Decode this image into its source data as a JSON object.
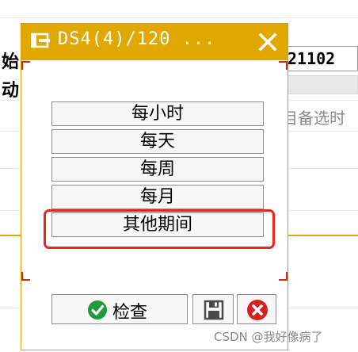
{
  "background": {
    "label_start": "始",
    "label_action": "动",
    "field_value": "21102",
    "hint_text": "目备选时"
  },
  "dialog": {
    "title": "DS4(4)/120 ...",
    "options": [
      {
        "label": "每小时"
      },
      {
        "label": "每天"
      },
      {
        "label": "每周"
      },
      {
        "label": "每月"
      },
      {
        "label": "其他期间"
      }
    ],
    "highlighted_option": "其他期间",
    "check_label": "检查"
  },
  "watermark": "CSDN @我好像病了",
  "colors": {
    "titlebar": "#e0a800",
    "highlight": "#e8261a",
    "check_icon": "#1e9b3a",
    "cancel_icon": "#d62020"
  }
}
